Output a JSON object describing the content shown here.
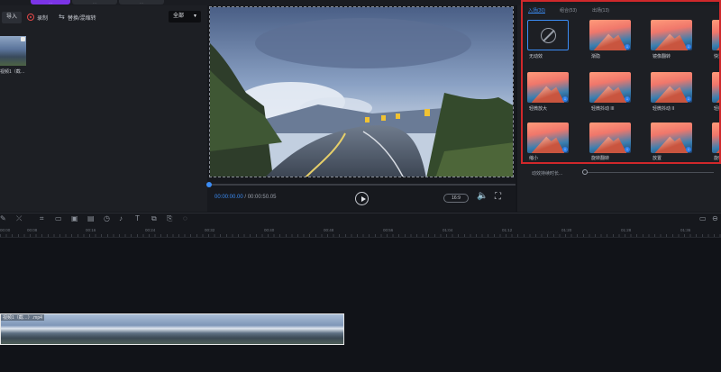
{
  "top_tabs": [
    {
      "label": "…",
      "active": true
    },
    {
      "label": "…",
      "active": false
    },
    {
      "label": "…",
      "active": false
    }
  ],
  "media": {
    "import_label": "导入",
    "record_label": "录制",
    "swap_label": "替换/混缩转",
    "filter_value": "全部",
    "clip_caption": "视频1（截…"
  },
  "player": {
    "current_time": "00:00:00.00",
    "separator": " / ",
    "total_time": "00:00:50.05",
    "aspect": "16:9"
  },
  "effects": {
    "tabs": [
      {
        "label": "入场(30)",
        "active": true
      },
      {
        "label": "组合(53)",
        "active": false
      },
      {
        "label": "出场(13)",
        "active": false
      }
    ],
    "items": [
      {
        "label": "无动效",
        "none": true
      },
      {
        "label": "渐隐"
      },
      {
        "label": "镜像翻转"
      },
      {
        "label": "快速…"
      },
      {
        "label": "轻微放大"
      },
      {
        "label": "轻微抖动 III"
      },
      {
        "label": "轻微抖动 II"
      },
      {
        "label": "轻微…"
      },
      {
        "label": "缩小"
      },
      {
        "label": "旋转翻转"
      },
      {
        "label": "放置"
      },
      {
        "label": "旋转…"
      }
    ],
    "duration_label": "动效持续时长..."
  },
  "timeline": {
    "ruler_labels": [
      "00:00",
      "00:08",
      "00:16",
      "00:24",
      "00:32",
      "00:40",
      "00:48",
      "00:56",
      "01:04",
      "01:12",
      "01:20",
      "01:28",
      "01:36"
    ],
    "clip_caption": "视频1（截…）.mp4"
  },
  "colors": {
    "accent": "#7b34e6",
    "highlight_blue": "#3b8cf5",
    "annotation_red": "#d0282b"
  }
}
